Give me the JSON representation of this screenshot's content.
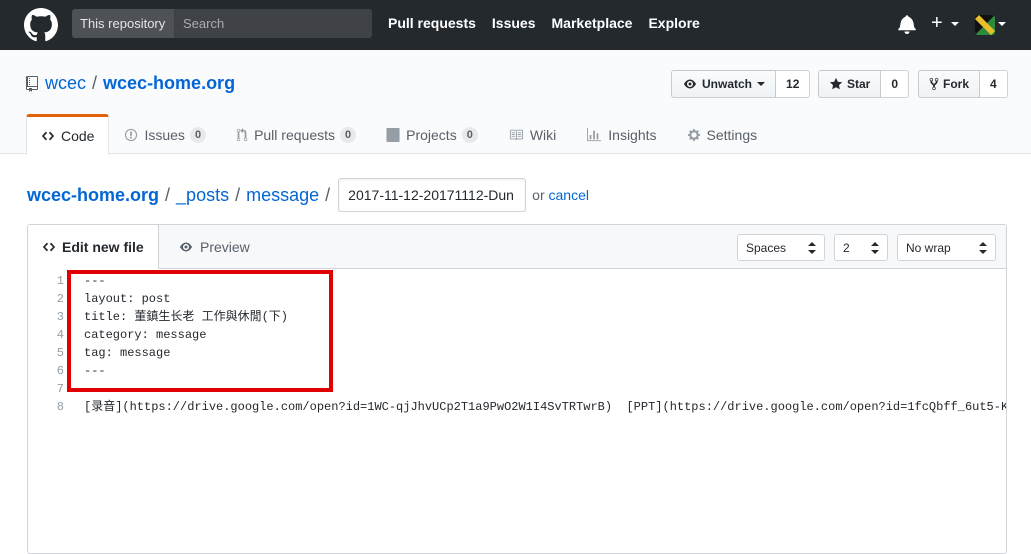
{
  "header": {
    "scope_label": "This repository",
    "search_placeholder": "Search",
    "nav": [
      "Pull requests",
      "Issues",
      "Marketplace",
      "Explore"
    ],
    "plus_symbol": "+"
  },
  "repo": {
    "owner": "wcec",
    "separator": "/",
    "name": "wcec-home.org",
    "unwatch_label": "Unwatch",
    "watch_count": "12",
    "star_label": "Star",
    "star_count": "0",
    "fork_label": "Fork",
    "fork_count": "4"
  },
  "tabs": [
    {
      "label": "Code",
      "icon": "code-icon",
      "selected": true
    },
    {
      "label": "Issues",
      "icon": "issue-icon",
      "counter": "0"
    },
    {
      "label": "Pull requests",
      "icon": "pull-request-icon",
      "counter": "0"
    },
    {
      "label": "Projects",
      "icon": "project-icon",
      "counter": "0"
    },
    {
      "label": "Wiki",
      "icon": "book-icon"
    },
    {
      "label": "Insights",
      "icon": "graph-icon"
    },
    {
      "label": "Settings",
      "icon": "gear-icon"
    }
  ],
  "breadcrumb": {
    "root": "wcec-home.org",
    "dirs": [
      "_posts",
      "message"
    ],
    "slash": "/",
    "filename_value": "2017-11-12-20171112-Dun",
    "or_text": "or",
    "cancel_label": "cancel"
  },
  "editor": {
    "edit_tab_label": "Edit new file",
    "preview_tab_label": "Preview",
    "indent_mode": "Spaces",
    "indent_size": "2",
    "wrap_mode": "No wrap",
    "lines": [
      {
        "num": "1",
        "text": "---"
      },
      {
        "num": "2",
        "text": "layout: post"
      },
      {
        "num": "3",
        "text": "title: 董鎮生长老 工作與休閒(下)"
      },
      {
        "num": "4",
        "text": "category: message"
      },
      {
        "num": "5",
        "text": "tag: message"
      },
      {
        "num": "6",
        "text": "---"
      },
      {
        "num": "7",
        "text": ""
      },
      {
        "num": "8",
        "text": "[录音](https://drive.google.com/open?id=1WC-qjJhvUCp2T1a9PwO2W1I4SvTRTwrB)  [PPT](https://drive.google.com/open?id=1fcQbff_6ut5-K"
      }
    ]
  },
  "colors": {
    "header_bg": "#24292e",
    "link": "#0366d6",
    "selected_tab_accent": "#e36209",
    "highlight_box": "#e00000"
  }
}
